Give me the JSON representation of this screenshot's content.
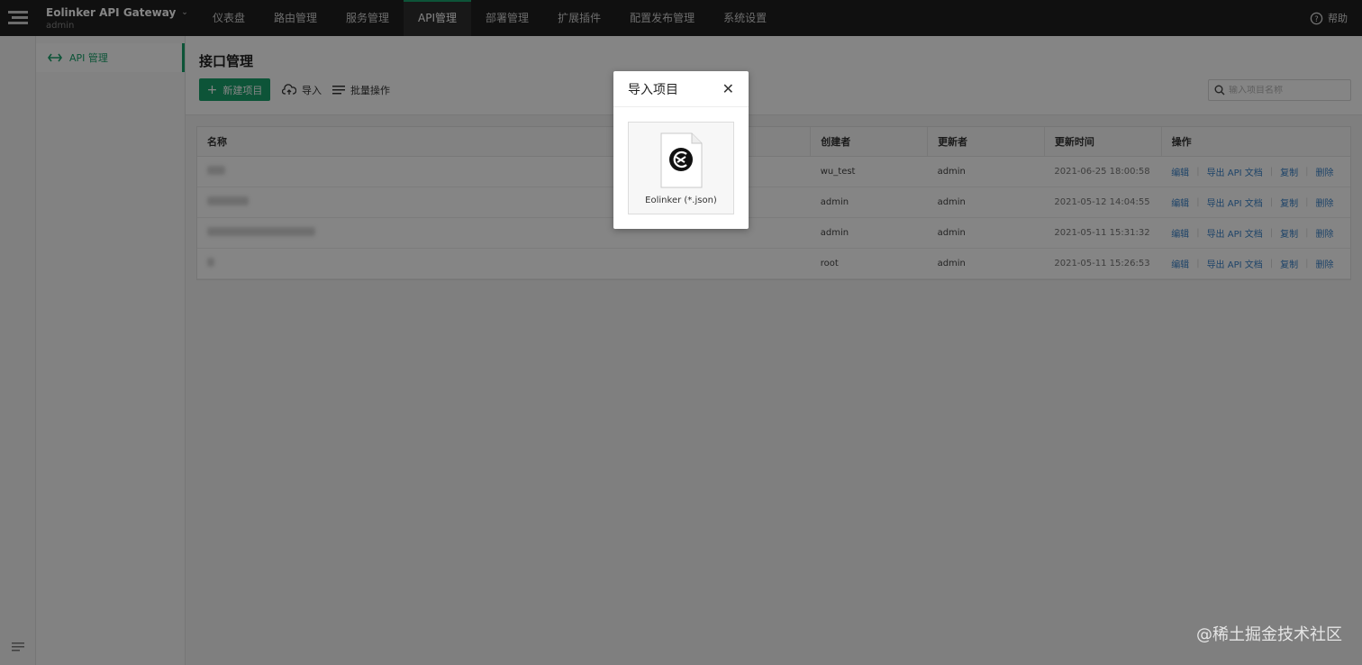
{
  "topbar": {
    "app_title": "Eolinker API Gateway",
    "user": "admin",
    "nav": [
      "仪表盘",
      "路由管理",
      "服务管理",
      "API管理",
      "部署管理",
      "扩展插件",
      "配置发布管理",
      "系统设置"
    ],
    "active_nav": "API管理",
    "help_label": "帮助"
  },
  "sidebar": {
    "items": [
      {
        "label": "API 管理",
        "icon": "code-arrows-icon"
      }
    ]
  },
  "main": {
    "title": "接口管理",
    "new_button": "新建项目",
    "import_button": "导入",
    "batch_button": "批量操作",
    "search_placeholder": "输入项目名称"
  },
  "table": {
    "columns": [
      "名称",
      "创建者",
      "更新者",
      "更新时间",
      "操作"
    ],
    "rows": [
      {
        "creator": "wu_test",
        "updater": "admin",
        "time": "2021-06-25 18:00:58"
      },
      {
        "creator": "admin",
        "updater": "admin",
        "time": "2021-05-12 14:04:55"
      },
      {
        "creator": "admin",
        "updater": "admin",
        "time": "2021-05-11 15:31:32"
      },
      {
        "creator": "root",
        "updater": "admin",
        "time": "2021-05-11 15:26:53"
      }
    ],
    "actions": [
      "编辑",
      "导出 API 文档",
      "复制",
      "删除"
    ]
  },
  "modal": {
    "title": "导入项目",
    "option_label": "Eolinker (*.json)"
  },
  "watermark": "@稀土掘金技术社区",
  "colors": {
    "accent": "#1aa26b",
    "link": "#3a83c9",
    "topbar": "#1f1f1f"
  }
}
